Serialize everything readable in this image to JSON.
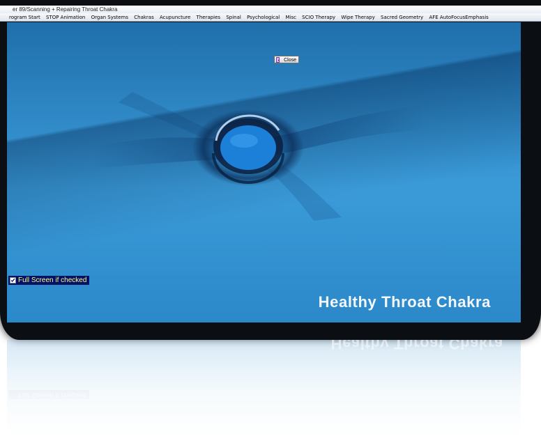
{
  "window": {
    "title": "er 89/Scanning + Repairing Throat Chakra"
  },
  "menu": {
    "items": [
      "rogram Start",
      "STOP Animation",
      "Organ Systems",
      "Chakras",
      "Acupuncture",
      "Therapies",
      "Spinal",
      "Psychological",
      "Misc",
      "SCIO Therapy",
      "Wipe Therapy",
      "Sacred Geometry",
      "AFE AutoFocusEmphasis"
    ]
  },
  "viewer": {
    "close_label": "Close",
    "fullscreen_label": "Full Screen if checked",
    "fullscreen_checked": true,
    "caption": "Healthy Throat Chakra"
  },
  "colors": {
    "background_top": "#1f6fab",
    "background_mid": "#3b9bd8",
    "orb": "#1c7fd8",
    "caption": "#f3f7fb",
    "checkbox_bg": "#001166",
    "checkbox_text": "#ffff80"
  },
  "icons": {
    "close": "close-door-icon",
    "checkbox": "check-icon"
  }
}
